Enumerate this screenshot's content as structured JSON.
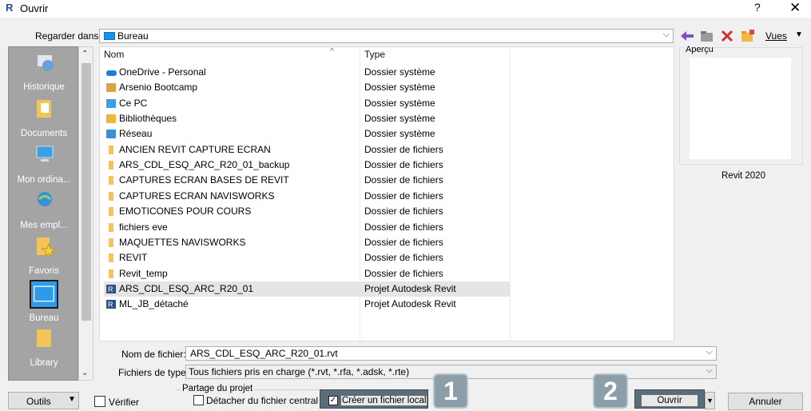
{
  "window": {
    "title": "Ouvrir",
    "help": "?",
    "close": "✕",
    "app_icon": "R"
  },
  "lookin": {
    "label": "Regarder dans:",
    "value": "Bureau"
  },
  "toolbar": {
    "views_label": "Vues"
  },
  "places": [
    {
      "label": "Historique",
      "icon": "history-icon"
    },
    {
      "label": "Documents",
      "icon": "documents-icon"
    },
    {
      "label": "Mon ordina...",
      "icon": "computer-icon"
    },
    {
      "label": "Mes empl...",
      "icon": "network-places-icon"
    },
    {
      "label": "Favoris",
      "icon": "favorites-icon"
    },
    {
      "label": "Bureau",
      "icon": "desktop-icon",
      "selected": true
    },
    {
      "label": "Library",
      "icon": "library-icon"
    }
  ],
  "columns": {
    "name": "Nom",
    "type": "Type"
  },
  "files": [
    {
      "name": "OneDrive - Personal",
      "type": "Dossier système",
      "icon": "onedrive-icon"
    },
    {
      "name": "Arsenio Bootcamp",
      "type": "Dossier système",
      "icon": "user-folder-icon"
    },
    {
      "name": "Ce PC",
      "type": "Dossier système",
      "icon": "pc-icon"
    },
    {
      "name": "Bibliothèques",
      "type": "Dossier système",
      "icon": "libraries-icon"
    },
    {
      "name": "Réseau",
      "type": "Dossier système",
      "icon": "network-icon"
    },
    {
      "name": "ANCIEN REVIT CAPTURE ECRAN",
      "type": "Dossier de fichiers",
      "icon": "folder-icon"
    },
    {
      "name": "ARS_CDL_ESQ_ARC_R20_01_backup",
      "type": "Dossier de fichiers",
      "icon": "folder-icon"
    },
    {
      "name": "CAPTURES ECRAN BASES DE REVIT",
      "type": "Dossier de fichiers",
      "icon": "folder-icon"
    },
    {
      "name": "CAPTURES ECRAN NAVISWORKS",
      "type": "Dossier de fichiers",
      "icon": "folder-icon"
    },
    {
      "name": "EMOTICONES POUR COURS",
      "type": "Dossier de fichiers",
      "icon": "folder-icon"
    },
    {
      "name": "fichiers eve",
      "type": "Dossier de fichiers",
      "icon": "folder-icon"
    },
    {
      "name": "MAQUETTES NAVISWORKS",
      "type": "Dossier de fichiers",
      "icon": "folder-icon"
    },
    {
      "name": "REVIT",
      "type": "Dossier de fichiers",
      "icon": "folder-icon"
    },
    {
      "name": "Revit_temp",
      "type": "Dossier de fichiers",
      "icon": "folder-icon"
    },
    {
      "name": "ARS_CDL_ESQ_ARC_R20_01",
      "type": "Projet Autodesk Revit",
      "icon": "revit-file-icon",
      "selected": true
    },
    {
      "name": "ML_JB_détaché",
      "type": "Projet Autodesk Revit",
      "icon": "revit-file-icon"
    }
  ],
  "preview": {
    "label": "Aperçu",
    "version": "Revit 2020"
  },
  "filename": {
    "label": "Nom de fichier:",
    "value": "ARS_CDL_ESQ_ARC_R20_01.rvt"
  },
  "filetype": {
    "label": "Fichiers de type:",
    "value": "Tous fichiers pris en charge  (*.rvt, *.rfa, *.adsk, *.rte)"
  },
  "bottom": {
    "tools_label": "Outils",
    "verify_label": "Vérifier",
    "share_legend": "Partage du projet",
    "detach_label": "Détacher du fichier central",
    "local_label": "Créer un fichier local",
    "badge1": "1",
    "badge2": "2",
    "open_label": "Ouvrir",
    "cancel_label": "Annuler"
  },
  "colors": {
    "accent": "#1e8fe6",
    "places_bg": "#a4a4a4",
    "badge": "#8b9ea9",
    "highlight": "#5a6d78"
  }
}
